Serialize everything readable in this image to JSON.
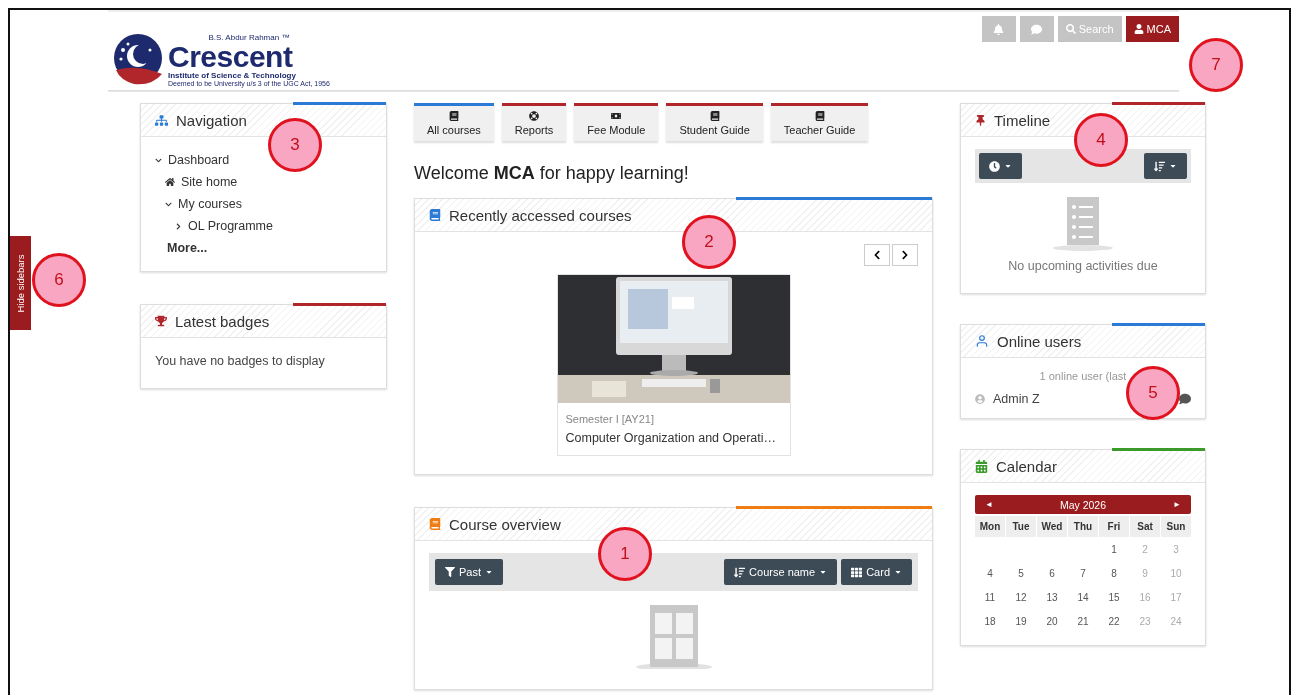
{
  "header": {
    "logo": {
      "top": "B.S. Abdur Rahman ™",
      "name": "Crescent",
      "sub": "Institute of Science & Technology",
      "fine": "Deemed to be University u/s 3 of the UGC Act, 1956"
    },
    "actions": [
      {
        "kind": "bell"
      },
      {
        "kind": "chat"
      },
      {
        "kind": "search",
        "label": "Search"
      },
      {
        "kind": "user",
        "label": "MCA"
      }
    ]
  },
  "hide_sidebars": "Hide sidebars",
  "navigation": {
    "title": "Navigation",
    "color": "#2a7ad6",
    "items": [
      {
        "label": "Dashboard",
        "kind": "branch",
        "expanded": true,
        "children": [
          {
            "label": "Site home",
            "kind": "home"
          },
          {
            "label": "My courses",
            "kind": "branch",
            "expanded": true,
            "children": [
              {
                "label": "OL Programme",
                "kind": "branch",
                "expanded": false
              }
            ]
          }
        ]
      },
      {
        "label": "More...",
        "kind": "more"
      }
    ]
  },
  "badges": {
    "title": "Latest badges",
    "color": "#b0262b",
    "text": "You have no badges to display"
  },
  "tiles": [
    {
      "label": "All courses",
      "kind": "book",
      "color": "#2a7ad6"
    },
    {
      "label": "Reports",
      "kind": "ring",
      "color": "#b0262b"
    },
    {
      "label": "Fee Module",
      "kind": "money",
      "color": "#b0262b"
    },
    {
      "label": "Student Guide",
      "kind": "book",
      "color": "#b0262b"
    },
    {
      "label": "Teacher Guide",
      "kind": "book",
      "color": "#b0262b"
    }
  ],
  "welcome": "Welcome **MCA** for happy learning!",
  "recent": {
    "title": "Recently accessed courses",
    "color": "#2a7ad6",
    "course": {
      "kind": "picture",
      "category": "Semester I [AY21]",
      "name": "Computer Organization and Operati…"
    }
  },
  "overview": {
    "title": "Course overview",
    "color": "#f07d12",
    "filter": "Past",
    "sort": "Course name",
    "view": "Card"
  },
  "timeline": {
    "title": "Timeline",
    "color": "#b0262b",
    "empty": "No upcoming activities due"
  },
  "online": {
    "title": "Online users",
    "color": "#2a7ad6",
    "summary": "1 online user (last",
    "users": [
      {
        "name": "Admin Z"
      }
    ]
  },
  "calendar": {
    "title": "Calendar",
    "color": "#3a9a2a",
    "month": "May 2026",
    "prev": "◄",
    "next": "►",
    "weekdays": [
      "Mon",
      "Tue",
      "Wed",
      "Thu",
      "Fri",
      "Sat",
      "Sun"
    ],
    "weeks": [
      [
        {
          "d": "1",
          "muted": false
        },
        {
          "d": "2",
          "muted": true
        },
        {
          "d": "3",
          "muted": true
        }
      ],
      [
        {
          "d": "4",
          "muted": false
        },
        {
          "d": "5",
          "muted": false
        },
        {
          "d": "6",
          "muted": false
        },
        {
          "d": "7",
          "muted": false
        },
        {
          "d": "8",
          "muted": false
        },
        {
          "d": "9",
          "muted": true
        },
        {
          "d": "10",
          "muted": true
        }
      ],
      [
        {
          "d": "11",
          "muted": false
        },
        {
          "d": "12",
          "muted": false
        },
        {
          "d": "13",
          "muted": false
        },
        {
          "d": "14",
          "muted": false
        },
        {
          "d": "15",
          "muted": false
        },
        {
          "d": "16",
          "muted": true
        },
        {
          "d": "17",
          "muted": true
        }
      ],
      [
        {
          "d": "18",
          "muted": false
        },
        {
          "d": "19",
          "muted": false
        },
        {
          "d": "20",
          "muted": false
        },
        {
          "d": "21",
          "muted": false
        },
        {
          "d": "22",
          "muted": false
        },
        {
          "d": "23",
          "muted": true
        },
        {
          "d": "24",
          "muted": true
        }
      ]
    ]
  },
  "callouts": [
    {
      "label": "1"
    },
    {
      "label": "2"
    },
    {
      "label": "3"
    },
    {
      "label": "4"
    },
    {
      "label": "5"
    },
    {
      "label": "6"
    },
    {
      "label": "7"
    }
  ]
}
